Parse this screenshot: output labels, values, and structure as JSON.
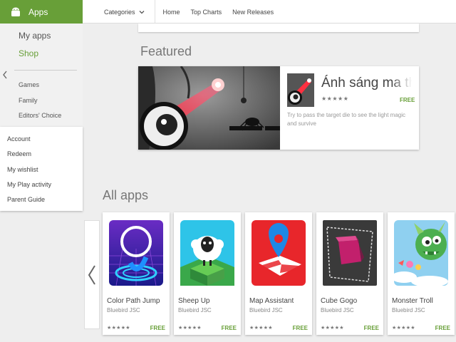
{
  "header": {
    "brand_label": "Apps",
    "categories_label": "Categories",
    "nav_links": [
      "Home",
      "Top Charts",
      "New Releases"
    ],
    "accent_color": "#689f38"
  },
  "sidebar": {
    "my_apps": "My apps",
    "shop": "Shop",
    "categories": [
      "Games",
      "Family",
      "Editors' Choice"
    ],
    "account_links": [
      "Account",
      "Redeem",
      "My wishlist",
      "My Play activity",
      "Parent Guide"
    ]
  },
  "featured": {
    "section_title": "Featured",
    "app_name": "Ánh sáng ma thuật",
    "rating": "★★★★★",
    "price": "FREE",
    "description": "Try to pass the target die to see the light magic and survive"
  },
  "all_apps": {
    "section_title": "All apps",
    "apps": [
      {
        "name": "Color Path Jump",
        "developer": "Bluebird JSC",
        "rating": "★★★★★",
        "price": "FREE",
        "icon": "color-path-jump-icon"
      },
      {
        "name": "Sheep Up",
        "developer": "Bluebird JSC",
        "rating": "★★★★★",
        "price": "FREE",
        "icon": "sheep-icon"
      },
      {
        "name": "Map Assistant",
        "developer": "Bluebird JSC",
        "rating": "★★★★★",
        "price": "FREE",
        "icon": "map-pin-icon"
      },
      {
        "name": "Cube Gogo",
        "developer": "Bluebird JSC",
        "rating": "★★★★★",
        "price": "FREE",
        "icon": "cube-icon"
      },
      {
        "name": "Monster Troll",
        "developer": "Bluebird JSC",
        "rating": "★★★★★",
        "price": "FREE",
        "icon": "monster-icon"
      }
    ]
  }
}
